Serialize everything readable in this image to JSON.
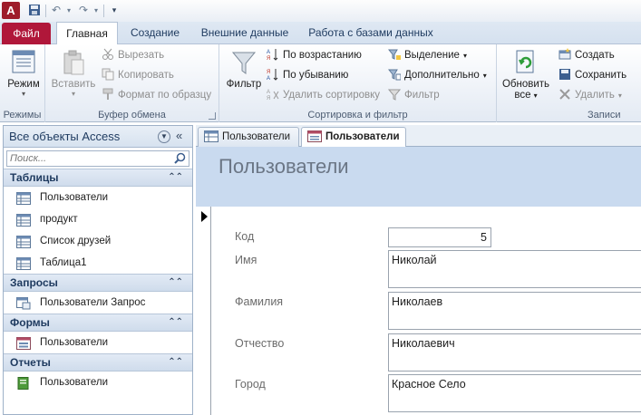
{
  "app": {
    "icon_letter": "A"
  },
  "ribbon_tabs": [
    "Файл",
    "Главная",
    "Создание",
    "Внешние данные",
    "Работа с базами данных"
  ],
  "ribbon": {
    "modes": {
      "view_label": "Режим",
      "group_label": "Режимы"
    },
    "clipboard": {
      "paste_label": "Вставить",
      "cut_label": "Вырезать",
      "copy_label": "Копировать",
      "format_label": "Формат по образцу",
      "group_label": "Буфер обмена"
    },
    "sort_filter": {
      "filter_label": "Фильтр",
      "asc_label": "По возрастанию",
      "desc_label": "По убыванию",
      "remove_sort_label": "Удалить сортировку",
      "selection_label": "Выделение",
      "advanced_label": "Дополнительно",
      "toggle_filter_label": "Фильтр",
      "group_label": "Сортировка и фильтр"
    },
    "records": {
      "refresh_label": "Обновить",
      "refresh_label2": "все",
      "new_label": "Создать",
      "save_label": "Сохранить",
      "delete_label": "Удалить",
      "group_label": "Записи"
    }
  },
  "nav": {
    "title": "Все объекты Access",
    "search_placeholder": "Поиск...",
    "sections": [
      {
        "name": "Таблицы",
        "items": [
          "Пользователи",
          "продукт",
          "Список друзей",
          "Таблица1"
        ]
      },
      {
        "name": "Запросы",
        "items": [
          "Пользователи Запрос"
        ]
      },
      {
        "name": "Формы",
        "items": [
          "Пользователи"
        ]
      },
      {
        "name": "Отчеты",
        "items": [
          "Пользователи"
        ]
      }
    ]
  },
  "doc_tabs": [
    "Пользователи",
    "Пользователи"
  ],
  "form": {
    "title": "Пользователи",
    "fields": [
      {
        "label": "Код",
        "value": "5"
      },
      {
        "label": "Имя",
        "value": "Николай"
      },
      {
        "label": "Фамилия",
        "value": "Николаев"
      },
      {
        "label": "Отчество",
        "value": "Николаевич"
      },
      {
        "label": "Город",
        "value": "Красное Село"
      }
    ]
  },
  "colors": {
    "file_tab": "#b0173a",
    "form_header": "#c9daef",
    "nav_section": "#cfdcec"
  }
}
